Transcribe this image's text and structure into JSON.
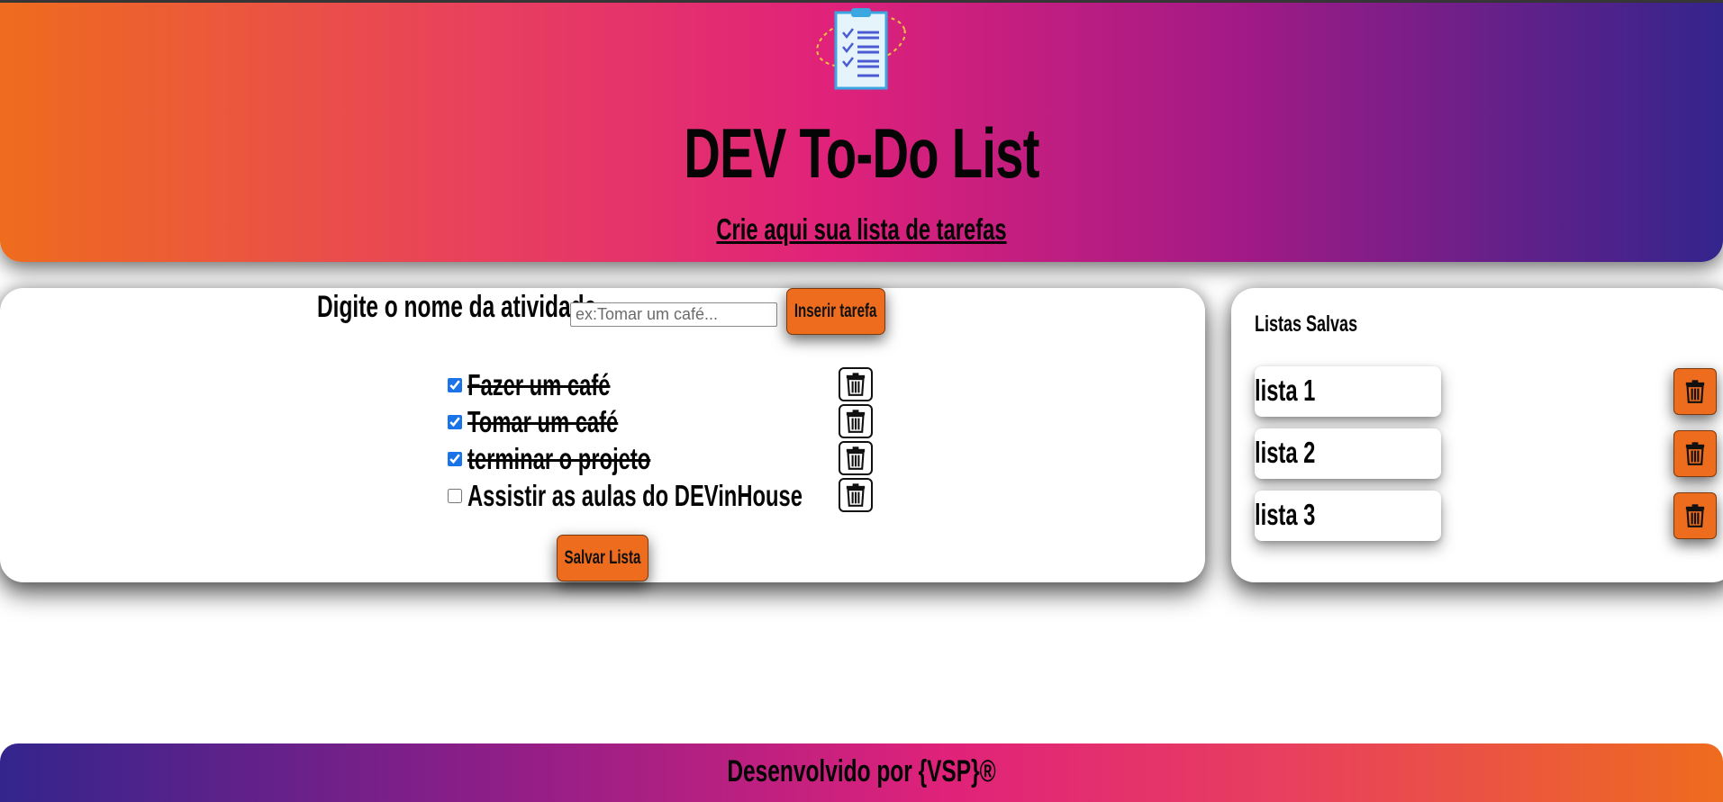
{
  "header": {
    "title": "DEV To-Do List",
    "subtitle": "Crie aqui sua lista de tarefas",
    "logo_icon": "clipboard-checklist-icon"
  },
  "form": {
    "label": "Digite o nome da atividade",
    "input_placeholder": "ex:Tomar um café...",
    "input_value": "",
    "insert_button": "Inserir tarefa"
  },
  "tasks": [
    {
      "text": "Fazer um café",
      "done": true
    },
    {
      "text": "Tomar um café",
      "done": true
    },
    {
      "text": "terminar o projeto",
      "done": true
    },
    {
      "text": "Assistir as aulas do DEVinHouse",
      "done": false
    }
  ],
  "save_button": "Salvar Lista",
  "saved_lists": {
    "title": "Listas Salvas",
    "items": [
      {
        "label": "lista 1"
      },
      {
        "label": "lista 2"
      },
      {
        "label": "lista 3"
      }
    ]
  },
  "footer": {
    "text": "Desenvolvido por {VSP}®"
  },
  "colors": {
    "accent_orange": "#ee6c1e",
    "gradient_pink": "#e0227a",
    "gradient_purple": "#33258c",
    "checkbox_blue": "#1a73e8"
  }
}
